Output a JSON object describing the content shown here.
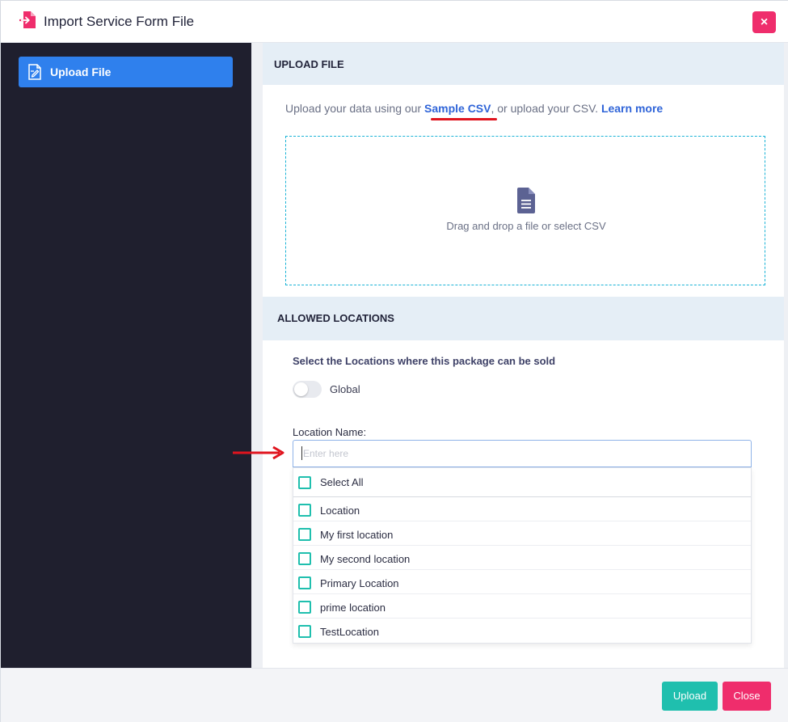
{
  "header": {
    "title": "Import Service Form File",
    "close_symbol": "×",
    "icon": "import-file-icon",
    "accent_color": "#ef2d6c"
  },
  "sidebar": {
    "items": [
      {
        "label": "Upload File",
        "icon": "upload-file-icon",
        "active": true
      }
    ],
    "background": "#1f1f2e",
    "active_color": "#2f80ed"
  },
  "upload_section": {
    "heading": "UPLOAD FILE",
    "intro_prefix": "Upload your data using our ",
    "sample_link": "Sample CSV",
    "intro_middle": ", or upload your CSV. ",
    "learn_more": "Learn more",
    "dropzone_text": "Drag and drop a file or select CSV",
    "dropzone_icon": "document-icon"
  },
  "locations_section": {
    "heading": "ALLOWED LOCATIONS",
    "prompt": "Select the Locations where this package can be sold",
    "global_label": "Global",
    "global_on": false,
    "field_label": "Location Name:",
    "placeholder": "Enter here",
    "select_all": "Select All",
    "options": [
      "Location",
      "My first location",
      "My second location",
      "Primary Location",
      "prime location",
      "TestLocation"
    ],
    "checkbox_color": "#1fbfae"
  },
  "footer": {
    "upload_label": "Upload",
    "close_label": "Close",
    "upload_color": "#1fbfae",
    "close_color": "#ef2d6c"
  }
}
